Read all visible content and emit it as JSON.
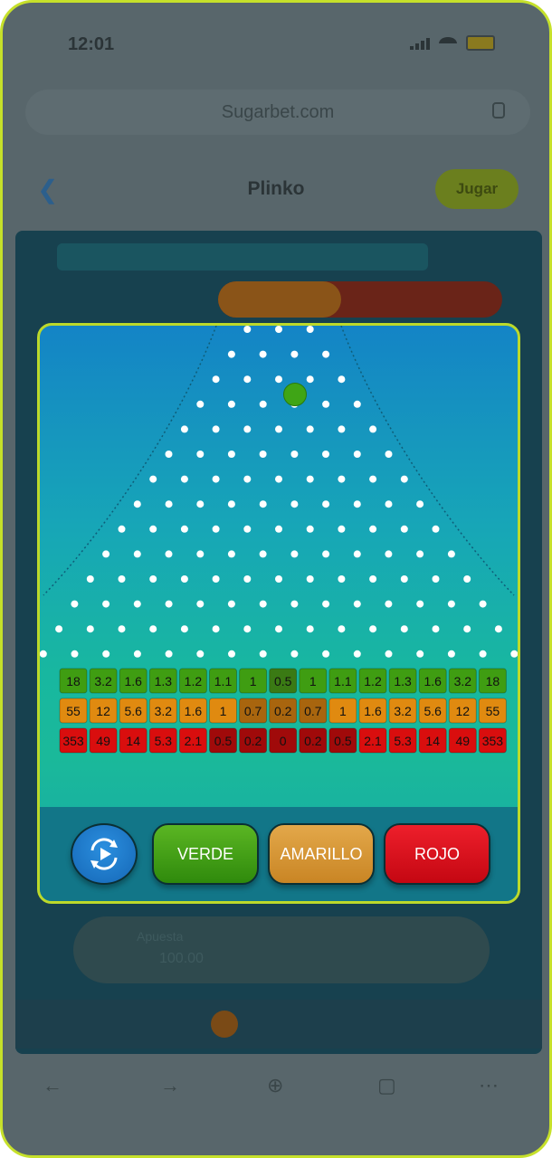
{
  "status_bar": {
    "time": "12:01"
  },
  "browser": {
    "url": "Sugarbet.com"
  },
  "header": {
    "title": "Plinko",
    "play_label": "Jugar"
  },
  "background": {
    "bet_label": "Apuesta",
    "bet_value": "100.00"
  },
  "game": {
    "pin_rows": 14,
    "rows": [
      {
        "color": "verde",
        "fill": "#3f9d12",
        "values": [
          "18",
          "3.2",
          "1.6",
          "1.3",
          "1.2",
          "1.1",
          "1",
          "0.5",
          "1",
          "1.1",
          "1.2",
          "1.3",
          "1.6",
          "3.2",
          "18"
        ]
      },
      {
        "color": "amarillo",
        "fill": "#e08a10",
        "values": [
          "55",
          "12",
          "5.6",
          "3.2",
          "1.6",
          "1",
          "0.7",
          "0.2",
          "0.7",
          "1",
          "1.6",
          "3.2",
          "5.6",
          "12",
          "55"
        ]
      },
      {
        "color": "rojo",
        "fill": "#d90e0e",
        "values": [
          "353",
          "49",
          "14",
          "5.3",
          "2.1",
          "0.5",
          "0.2",
          "0",
          "0.2",
          "0.5",
          "2.1",
          "5.3",
          "14",
          "49",
          "353"
        ]
      }
    ],
    "buttons": {
      "verde": "VERDE",
      "amarillo": "AMARILLO",
      "rojo": "ROJO"
    },
    "colors": {
      "verde": "#3f9d12",
      "amarillo": "#e08a10",
      "rojo": "#d90e0e",
      "ball": "#3fa516"
    }
  }
}
